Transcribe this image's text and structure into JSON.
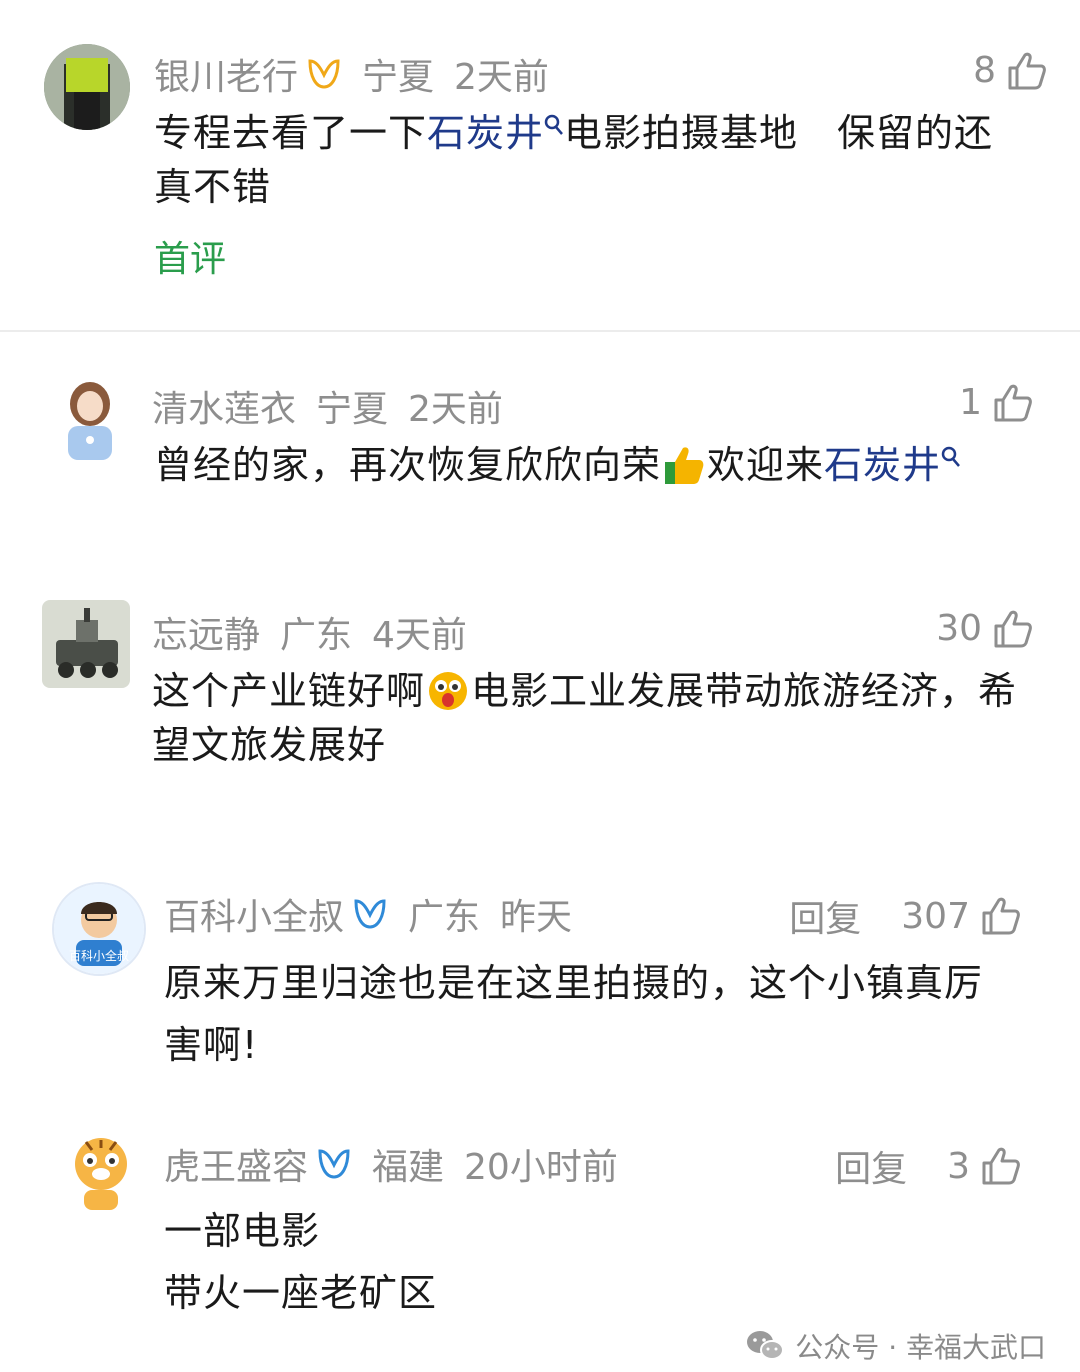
{
  "comments": [
    {
      "user": "银川老行",
      "location": "宁夏",
      "time": "2天前",
      "likes": "8",
      "text_parts": [
        "专程去看了一下",
        "石炭井",
        "电影拍摄基地　保留的还",
        "真不错"
      ],
      "label": "首评"
    },
    {
      "user": "清水莲衣",
      "location": "宁夏",
      "time": "2天前",
      "likes": "1",
      "text_parts": [
        "曾经的家，再次恢复欣欣向荣",
        "欢迎来",
        "石炭井"
      ]
    },
    {
      "user": "忘远静",
      "location": "广东",
      "time": "4天前",
      "likes": "30",
      "text_parts": [
        "这个产业链好啊",
        "电影工业发展带动旅游经济，希",
        "望文旅发展好"
      ]
    },
    {
      "user": "百科小全叔",
      "location": "广东",
      "time": "昨天",
      "reply": "回复",
      "likes": "307",
      "text_parts": [
        "原来万里归途也是在这里拍摄的，这个小镇真厉",
        "害啊!"
      ]
    },
    {
      "user": "虎王盛容",
      "location": "福建",
      "time": "20小时前",
      "reply": "回复",
      "likes": "3",
      "text_parts": [
        "一部电影",
        "带火一座老矿区"
      ]
    }
  ],
  "watermark": {
    "text": "公众号 · 幸福大武口",
    "icon": "wechat-icon"
  },
  "colors": {
    "meta_gray": "#8e8e8e",
    "link_blue": "#1f3a8a",
    "first_green": "#2a9d4c",
    "badge_gold": "#f0a818",
    "badge_blue": "#2f8ad8"
  }
}
